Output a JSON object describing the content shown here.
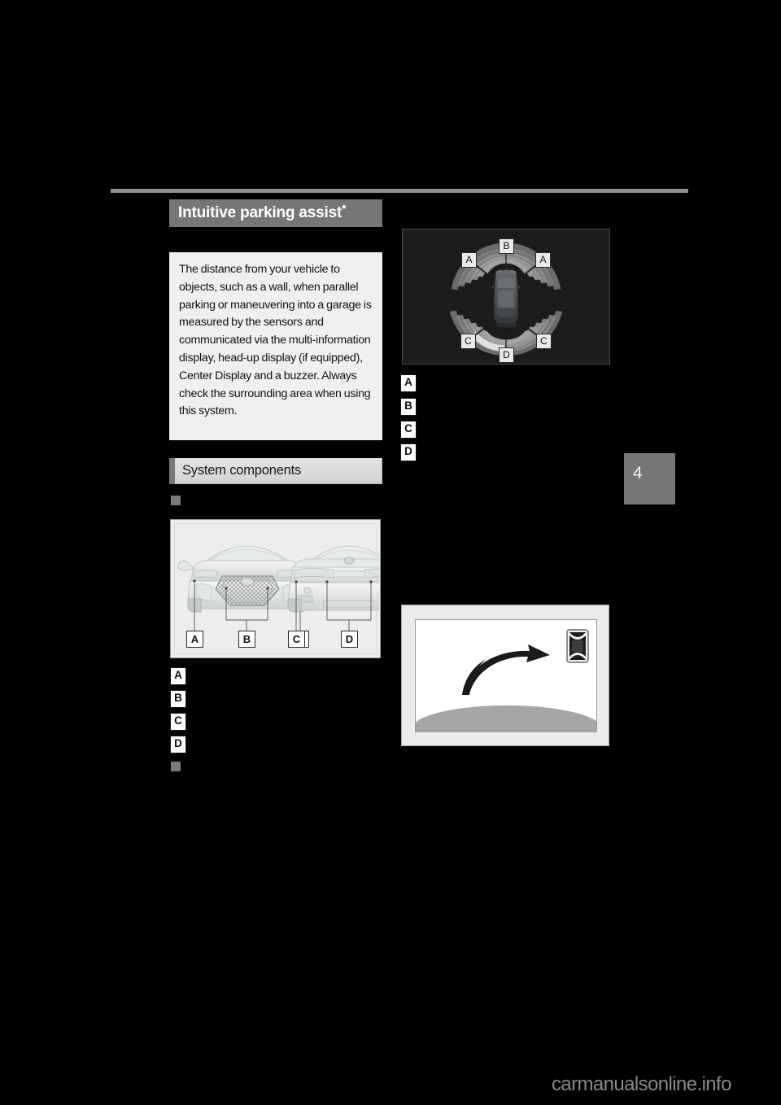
{
  "page": {
    "background_color": "#000000",
    "watermark": "carmanualsonline.info",
    "chapter_tab": "4"
  },
  "section": {
    "title": "Intuitive parking assist",
    "title_superscript": "*",
    "intro_text": "The distance from your vehicle to objects, such as a wall, when parallel parking or maneuvering into a garage is measured by the sensors and communicated via the multi-information display, head-up display (if equipped), Center Display and a buzzer. Always check the surrounding area when using this system."
  },
  "subsection": {
    "heading": "System components"
  },
  "sensor_figure": {
    "front_labels": [
      "A",
      "B",
      "A"
    ],
    "rear_labels": [
      "C",
      "D",
      "C"
    ]
  },
  "display_figure": {
    "labels": {
      "top_left": "A",
      "top_center": "B",
      "top_right": "A",
      "bottom_left": "C",
      "bottom_center": "D",
      "bottom_right": "C"
    }
  },
  "left_list": {
    "items": [
      {
        "marker": "A",
        "text": ""
      },
      {
        "marker": "B",
        "text": ""
      },
      {
        "marker": "C",
        "text": ""
      },
      {
        "marker": "D",
        "text": ""
      }
    ]
  },
  "right_list": {
    "items": [
      {
        "marker": "A",
        "text": ""
      },
      {
        "marker": "B",
        "text": ""
      },
      {
        "marker": "C",
        "text": ""
      },
      {
        "marker": "D",
        "text": ""
      }
    ]
  }
}
